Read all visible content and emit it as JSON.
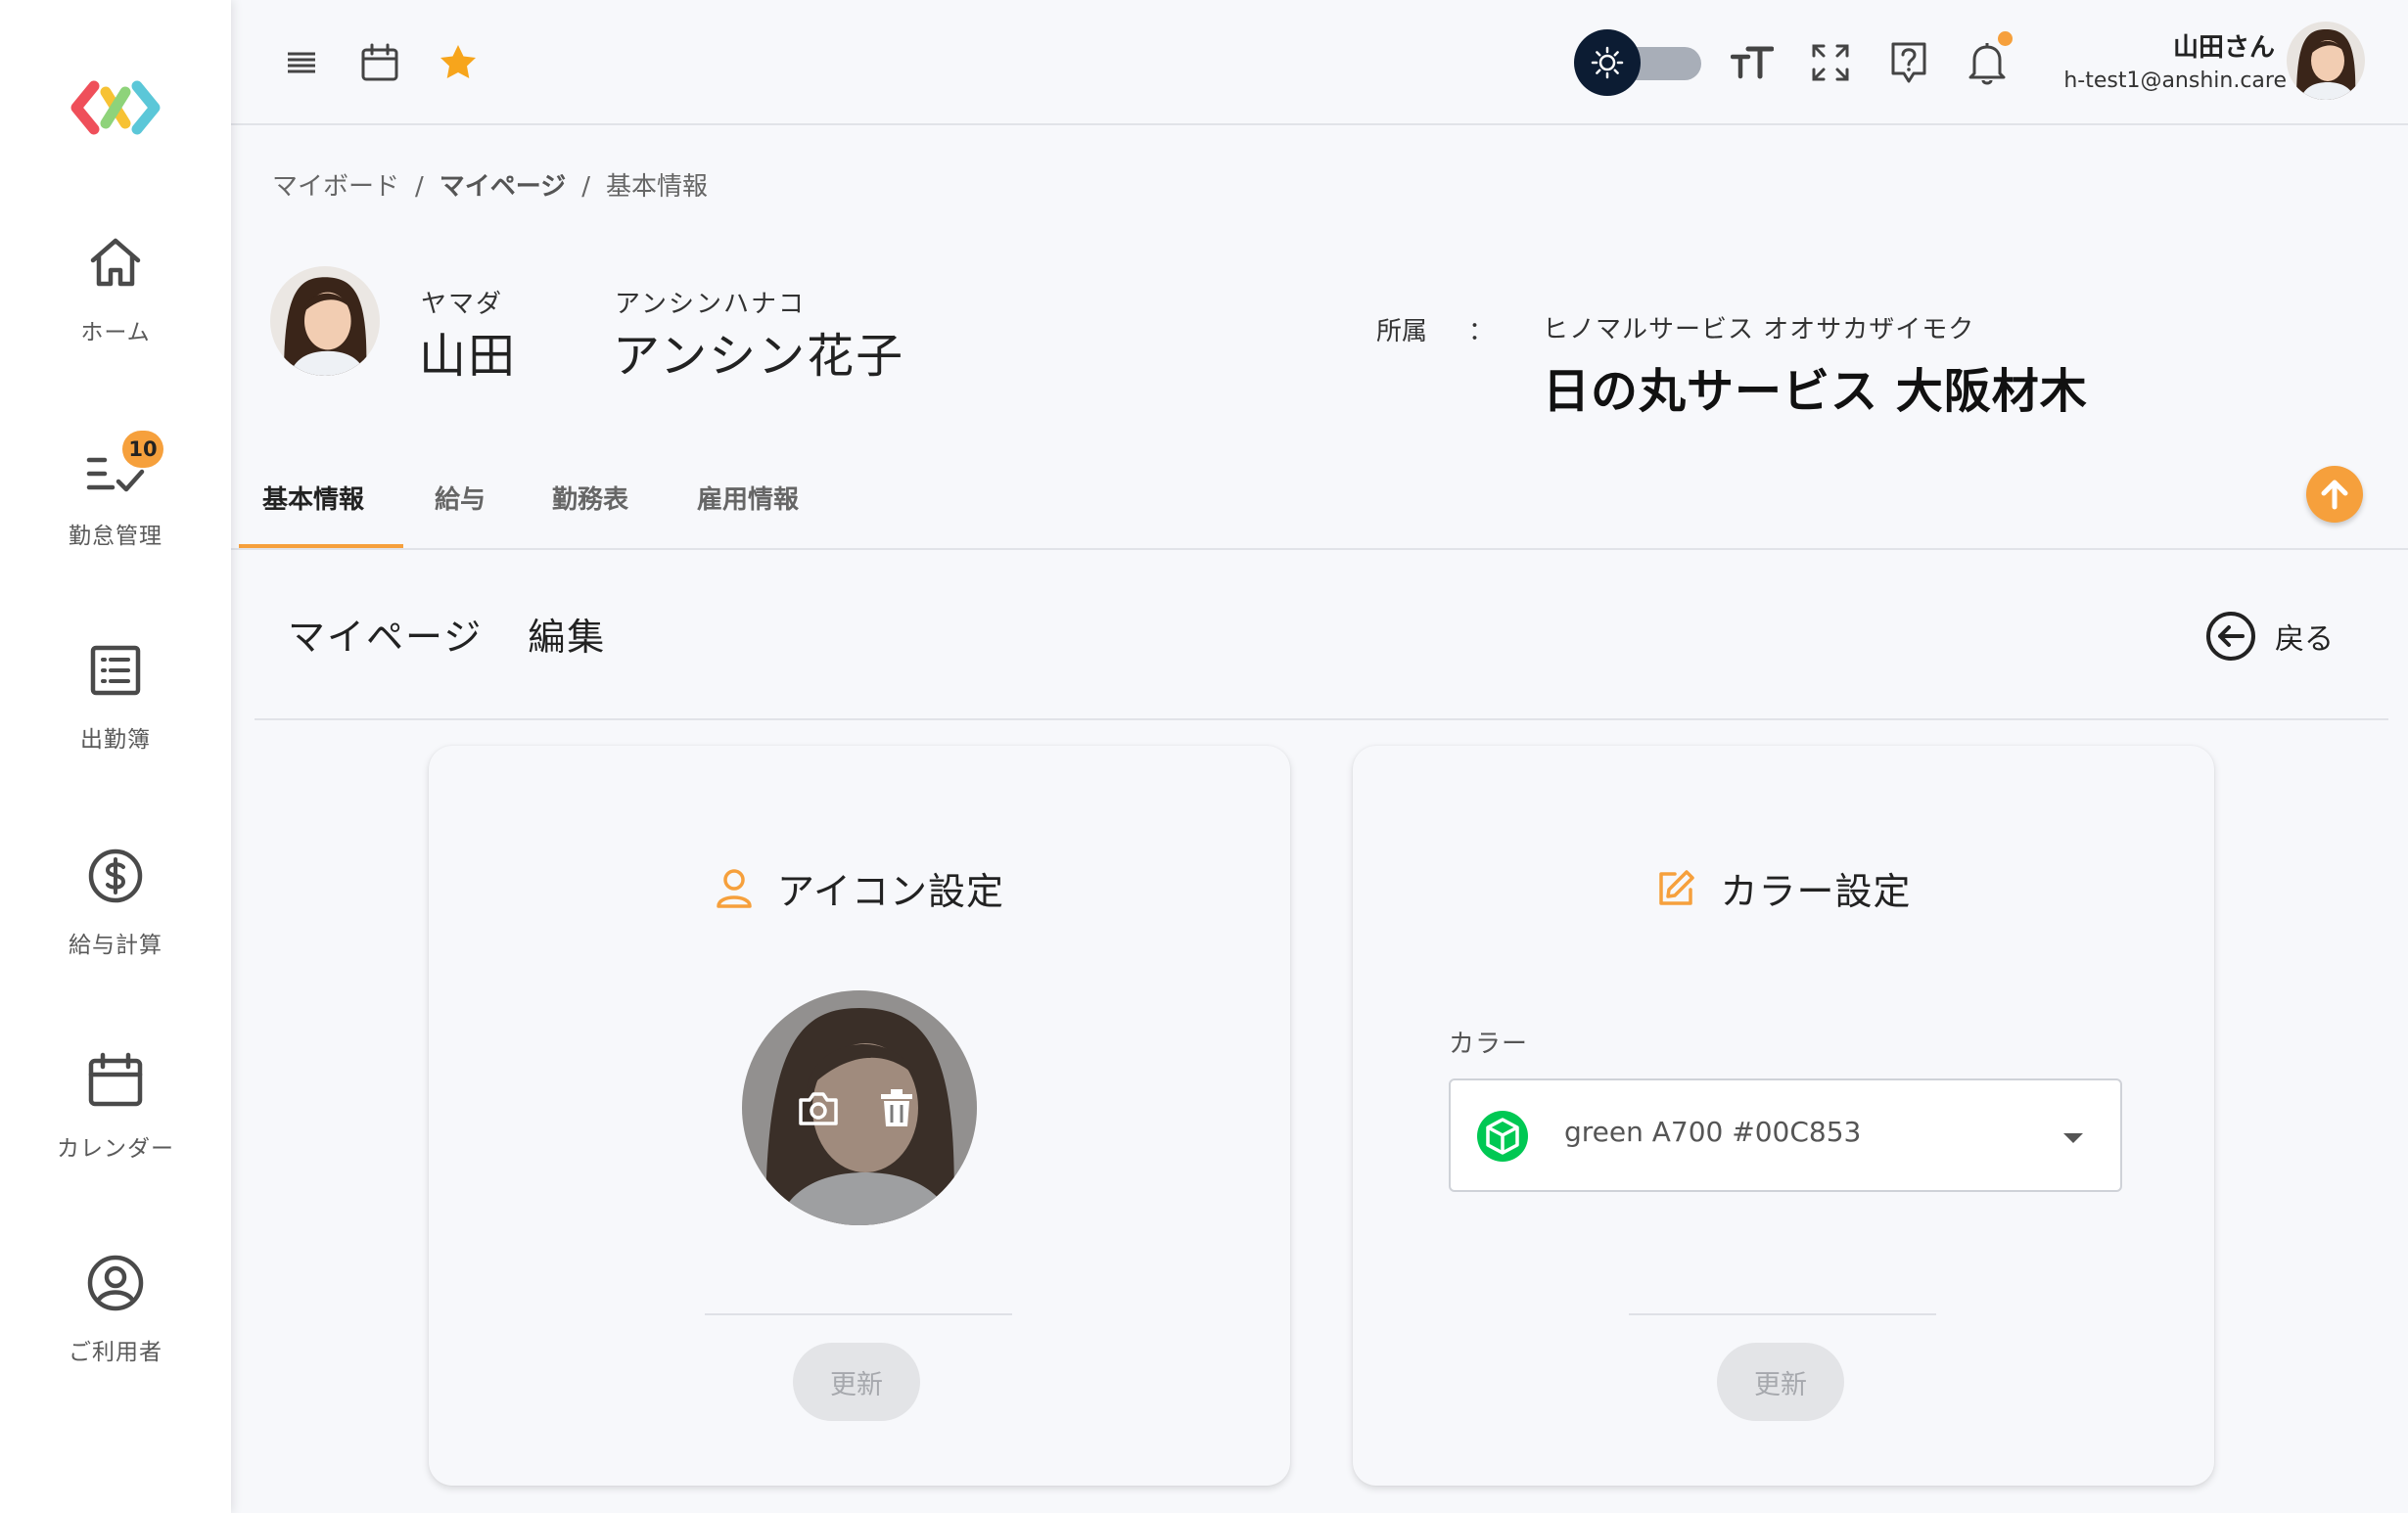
{
  "sidebar": {
    "items": [
      {
        "label": "ホーム",
        "icon": "home-icon"
      },
      {
        "label": "勤怠管理",
        "icon": "task-check-icon",
        "badge": "10"
      },
      {
        "label": "出勤簿",
        "icon": "list-icon"
      },
      {
        "label": "給与計算",
        "icon": "dollar-icon"
      },
      {
        "label": "カレンダー",
        "icon": "calendar-icon"
      },
      {
        "label": "ご利用者",
        "icon": "user-circle-icon"
      }
    ]
  },
  "topbar": {
    "user_name": "山田さん",
    "user_email": "h-test1@anshin.care"
  },
  "breadcrumb": [
    "マイボード",
    "マイページ",
    "基本情報"
  ],
  "profile": {
    "last_name_kana": "ヤマダ",
    "last_name": "山田",
    "first_name_kana": "アンシンハナコ",
    "first_name": "アンシン花子",
    "affiliation_label": "所属",
    "affiliation_colon": "：",
    "affiliation_kana": "ヒノマルサービス オオサカザイモク",
    "affiliation_name": "日の丸サービス 大阪材木"
  },
  "tabs": [
    "基本情報",
    "給与",
    "勤務表",
    "雇用情報"
  ],
  "section": {
    "title_1": "マイページ",
    "title_2": "編集",
    "back_label": "戻る"
  },
  "icon_card": {
    "title": "アイコン設定",
    "update_label": "更新"
  },
  "color_card": {
    "title": "カラー設定",
    "field_label": "カラー",
    "selected_value": "green A700 #00C853",
    "swatch_color": "#00C853",
    "update_label": "更新"
  },
  "colors": {
    "accent": "#f6a03c",
    "dark": "#0c1c33"
  }
}
